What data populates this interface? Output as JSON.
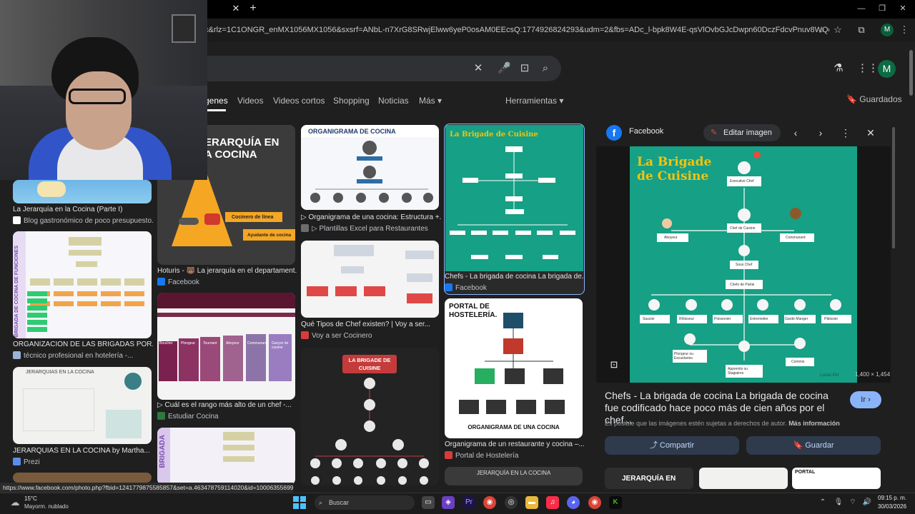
{
  "browser": {
    "url": "5c&rlz=1C1ONGR_enMX1056MX1056&sxsrf=ANbL-n7XrG8SRwjElww6yeP0osAM0EEcsQ:1774926824293&udm=2&fbs=ADc_l-bpk8W4E-qsVlOvbGJcDwpn60DczFdcvPnuv8WQohHLTaMb_WtLz8zQ41bNqi...",
    "status_url": "https://www.facebook.com/photo.php?fbid=1241779875585857&set=a.463478759114020&id=100063556991053",
    "profile_initial": "M"
  },
  "google": {
    "avatar_initial": "M",
    "tabs": [
      "genes",
      "Videos",
      "Videos cortos",
      "Shopping",
      "Noticias",
      "Más ▾",
      "Herramientas ▾"
    ],
    "saved_label": "Guardados"
  },
  "results": [
    {
      "caption": "La Jerarquía en la Cocina (Parte I)",
      "source": "Blog gastronómico de poco presupuesto..."
    },
    {
      "caption": "ORGANIZACIÓN DE LAS BRIGADAS POR...",
      "source": "técnico profesional en hotelería -..."
    },
    {
      "caption": "JERARQUIAS EN LA COCINA by Martha...",
      "source": "Prezi"
    },
    {
      "caption": "Hoturis - 🐻 La jerarquía en el departament...",
      "source": "Facebook"
    },
    {
      "caption": "▷ Cuál es el rango más alto de un chef -...",
      "source": "Estudiar Cocina"
    },
    {
      "caption": "▷ Organigrama de una cocina: Estructura +...",
      "source": "▷ Plantillas Excel para Restaurantes"
    },
    {
      "caption": "Qué Tipos de Chef existen? | Voy a ser...",
      "source": "Voy a ser Cocinero"
    },
    {
      "caption": "Chefs - La brigada de cocina La brigada de...",
      "source": "Facebook"
    },
    {
      "caption": "Organigrama de un restaurante y cocina –...",
      "source": "Portal de Hostelería"
    }
  ],
  "thumb_text": {
    "pyramid_title_1": "ERARQUÍA EN",
    "pyramid_title_2": "A COCINA",
    "pyramid_l1": "Cocinero de línea",
    "pyramid_l2": "Ayudante de cocina",
    "organigrama_title": "ORGANIGRAMA DE COCINA",
    "brigade_title": "La Brigade de Cuisine",
    "brigade_dark_title": "LA BRIGADE DE CUISINE",
    "portal_title": "PORTAL DE HOSTELERÍA.",
    "portal_footer": "ORGANIGRAMA DE UNA COCINA",
    "jerarquias_title": "JERARQUIAS EN LA COCINA",
    "jerarquia_bottom": "JERARQUÍA EN LA COCINA",
    "brigada_side": "BRIGADA DE COCINA DE FUNCIONES",
    "brigada_side2": "BRIGADA",
    "purple_cols": [
      "Boucher",
      "Plongeur",
      "Tournant",
      "Aboyeur",
      "Communard",
      "Garçon de cuisine"
    ]
  },
  "panel": {
    "source": "Facebook",
    "edit_label": "Editar imagen",
    "dimensions": "1,400 × 1,454",
    "title": "Chefs - La brigada de cocina La brigada de cocina fue codificado hace poco más de cien años por el chef...",
    "go_label": "Ir",
    "copyright": "Es posible que las imágenes estén sujetas a derechos de autor.",
    "more_info": "Más información",
    "share_label": "Compartir",
    "save_label": "Guardar",
    "more_thumb_text": [
      "JERARQUÍA EN",
      "PORTAL"
    ]
  },
  "brigade": {
    "title_1": "La Brigade",
    "title_2": "de Cuisine",
    "executive": "Executive Chef",
    "chef_de_cuisine": "Chef de Cuisine",
    "aboyeur": "Aboyeur",
    "communard": "Communard",
    "sous_chef": "Sous Chef",
    "chefs_de_partie": "Chefs de Partie",
    "stations": [
      "Saucier",
      "Rôtisseur",
      "Poissonier",
      "Entremetier",
      "Garde Manger",
      "Pâtissier"
    ],
    "plongeur": "Plongeur ou Escuelaries",
    "apprentis": "Apprentis ou Stagiaires",
    "commis": "Commis",
    "signature": "Lucas Pin"
  },
  "taskbar": {
    "temp": "15°C",
    "weather": "Mayorm. nublado",
    "search": "Buscar",
    "time": "09:15 p. m.",
    "date": "30/03/2026"
  }
}
